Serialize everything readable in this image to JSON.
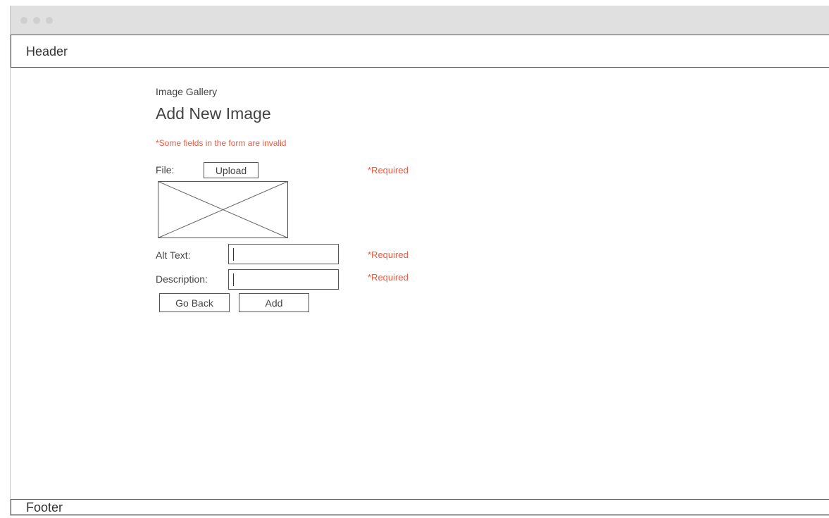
{
  "header": {
    "label": "Header"
  },
  "footer": {
    "label": "Footer"
  },
  "breadcrumb": "Image Gallery",
  "page_title": "Add New Image",
  "form": {
    "error_message": "*Some fields in the form are invalid",
    "file_label": "File:",
    "upload_label": "Upload",
    "file_required": "*Required",
    "alt_text_label": "Alt Text:",
    "alt_text_value": "",
    "alt_text_required": "*Required",
    "description_label": "Description:",
    "description_value": "",
    "description_required": "*Required",
    "go_back_label": "Go Back",
    "add_label": "Add"
  },
  "colors": {
    "error": "#f2553a",
    "titlebar": "#e0e0e0",
    "border": "#555555"
  }
}
